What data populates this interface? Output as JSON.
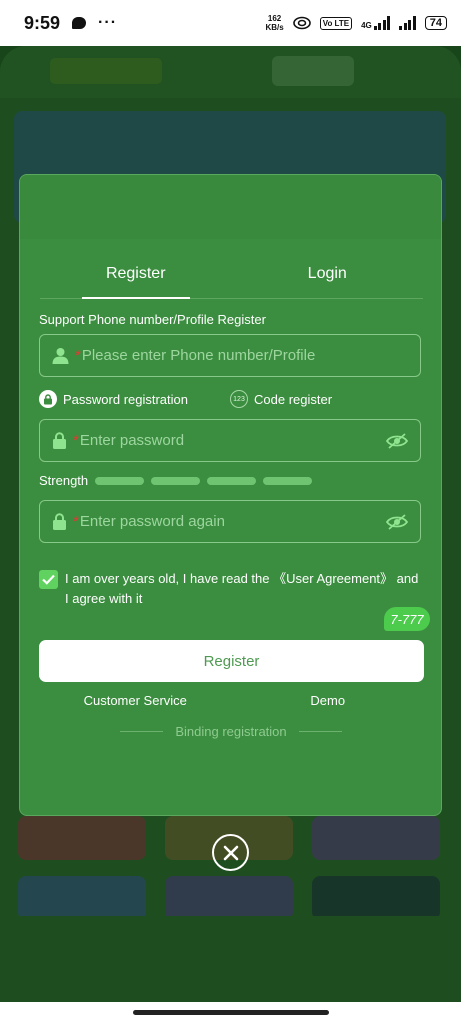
{
  "status_bar": {
    "time": "9:59",
    "dots": "···",
    "net_speed_value": "162",
    "net_speed_unit": "KB/s",
    "volte": "Vo LTE",
    "network": "4G",
    "battery": "74"
  },
  "tabs": [
    {
      "label": "Register",
      "active": true
    },
    {
      "label": "Login",
      "active": false
    }
  ],
  "form": {
    "phone_label": "Support Phone number/Profile Register",
    "required_mark": "*",
    "phone_placeholder": "Please enter Phone number/Profile",
    "mode_password": "Password registration",
    "mode_code": "Code register",
    "password_placeholder": "Enter password",
    "strength_label": "Strength",
    "password_again_placeholder": "Enter password again",
    "agreement_text": "I am over years old, I have read the 《User Agreement》 and I agree with it",
    "agreement_checked": true
  },
  "chip_label": "7-777",
  "register_button": "Register",
  "links": {
    "customer_service": "Customer Service",
    "demo": "Demo"
  },
  "binding_label": "Binding registration",
  "icons": {
    "user": "user-icon",
    "lock": "lock-icon",
    "eye_off": "eye-off-icon",
    "close": "close-icon",
    "check": "check-icon"
  },
  "colors": {
    "modal_bg": "#3b8d3f",
    "accent_green": "#5fd25f",
    "required": "#e53935"
  }
}
